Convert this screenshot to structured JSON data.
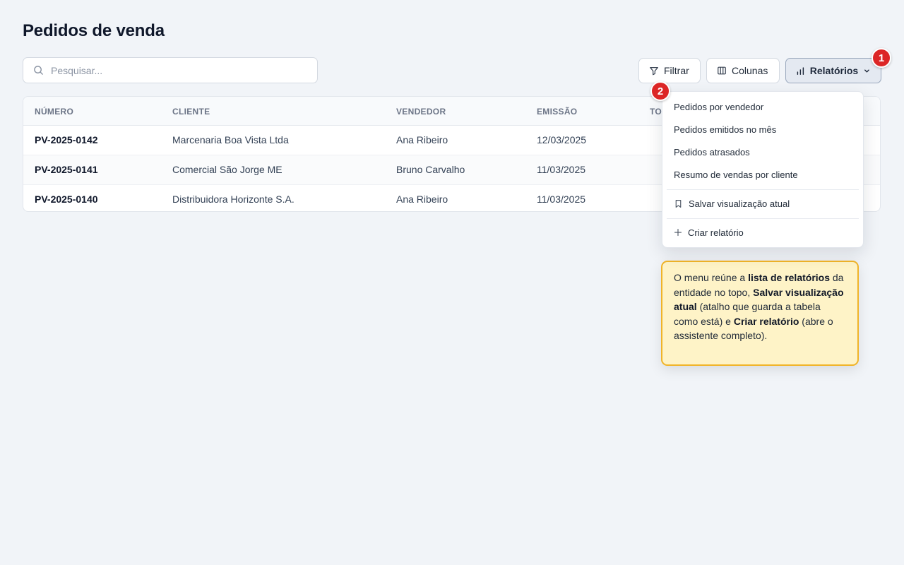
{
  "page": {
    "title": "Pedidos de venda"
  },
  "search": {
    "placeholder": "Pesquisar..."
  },
  "toolbar": {
    "filter_label": "Filtrar",
    "columns_label": "Colunas",
    "reports_label": "Relatórios"
  },
  "badges": [
    "1",
    "2"
  ],
  "table": {
    "headers": [
      "NÚMERO",
      "CLIENTE",
      "VENDEDOR",
      "EMISSÃO",
      "TO"
    ],
    "rows": [
      {
        "numero": "PV-2025-0142",
        "cliente": "Marcenaria Boa Vista Ltda",
        "vendedor": "Ana Ribeiro",
        "emissao": "12/03/2025"
      },
      {
        "numero": "PV-2025-0141",
        "cliente": "Comercial São Jorge ME",
        "vendedor": "Bruno Carvalho",
        "emissao": "11/03/2025"
      },
      {
        "numero": "PV-2025-0140",
        "cliente": "Distribuidora Horizonte S.A.",
        "vendedor": "Ana Ribeiro",
        "emissao": "11/03/2025"
      }
    ]
  },
  "reports_menu": {
    "reports": [
      "Pedidos por vendedor",
      "Pedidos emitidos no mês",
      "Pedidos atrasados",
      "Resumo de vendas por cliente"
    ],
    "save_view": "Salvar visualização atual",
    "create_report": "Criar relatório"
  },
  "tooltip": {
    "t1": "O menu reúne a ",
    "b1": "lista de relatórios",
    "t2": " da entidade no topo, ",
    "b2": "Salvar visualização atual",
    "t3": " (atalho que guarda a tabela como está) e ",
    "b3": "Criar relatório",
    "t4": " (abre o assistente completo)."
  },
  "colors": {
    "badge": "#dc2626",
    "tooltip_bg": "#fef3c7",
    "tooltip_border": "#f0b429",
    "page_bg": "#f1f4f8"
  },
  "icons": [
    "search-icon",
    "filter-icon",
    "columns-icon",
    "bar-chart-icon",
    "chevron-down-icon",
    "bookmark-icon",
    "plus-icon"
  ]
}
